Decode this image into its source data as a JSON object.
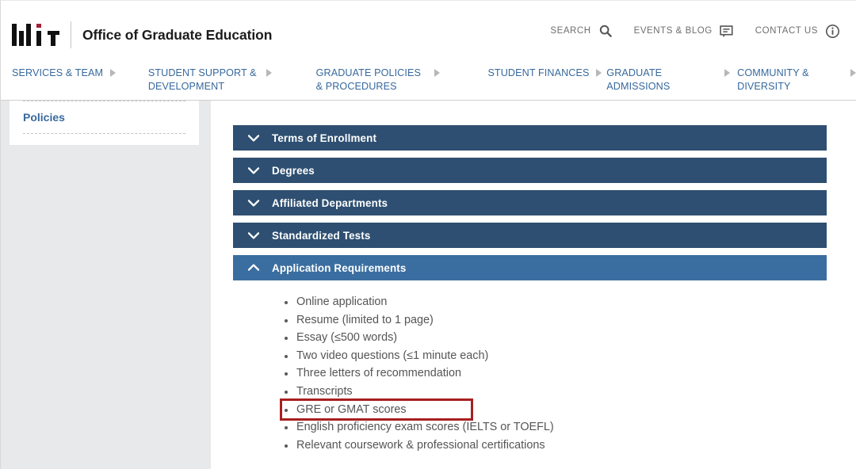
{
  "header": {
    "logo_name": "mit-logo",
    "site_title": "Office of Graduate Education",
    "utility_nav": [
      {
        "label": "SEARCH",
        "icon": "search-icon"
      },
      {
        "label": "EVENTS & BLOG",
        "icon": "speech-bubble-icon"
      },
      {
        "label": "CONTACT US",
        "icon": "info-circle-icon"
      }
    ]
  },
  "main_nav": {
    "items": [
      {
        "label": "SERVICES & TEAM",
        "arrow": "triangle-right-icon"
      },
      {
        "label": "STUDENT SUPPORT & DEVELOPMENT",
        "arrow": "triangle-right-icon"
      },
      {
        "label": "GRADUATE POLICIES & PROCEDURES",
        "arrow": "triangle-right-icon"
      },
      {
        "label": "STUDENT FINANCES",
        "arrow": "triangle-right-icon"
      },
      {
        "label": "GRADUATE ADMISSIONS",
        "arrow": "triangle-right-icon"
      },
      {
        "label": "COMMUNITY & DIVERSITY",
        "arrow": "triangle-right-icon"
      }
    ]
  },
  "sidebar": {
    "link_label": "Policies"
  },
  "accordion": {
    "sections": [
      {
        "label": "Terms of Enrollment",
        "expanded": false,
        "icon": "chevron-down-icon"
      },
      {
        "label": "Degrees",
        "expanded": false,
        "icon": "chevron-down-icon"
      },
      {
        "label": "Affiliated Departments",
        "expanded": false,
        "icon": "chevron-down-icon"
      },
      {
        "label": "Standardized Tests",
        "expanded": false,
        "icon": "chevron-down-icon"
      },
      {
        "label": "Application Requirements",
        "expanded": true,
        "icon": "chevron-up-icon"
      }
    ],
    "expanded_items": [
      {
        "text": "Online application",
        "highlighted": false
      },
      {
        "text": "Resume (limited to 1 page)",
        "highlighted": false
      },
      {
        "text": "Essay (≤500 words)",
        "highlighted": false
      },
      {
        "text": "Two video questions (≤1 minute each)",
        "highlighted": false
      },
      {
        "text": "Three letters of recommendation",
        "highlighted": false
      },
      {
        "text": "Transcripts",
        "highlighted": false
      },
      {
        "text": "GRE or GMAT scores",
        "highlighted": true
      },
      {
        "text": "English proficiency exam scores (IELTS or TOEFL)",
        "highlighted": false
      },
      {
        "text": "Relevant coursework & professional certifications",
        "highlighted": false
      }
    ]
  },
  "colors": {
    "accent_blue": "#37699e",
    "accordion_navy": "#2e4f71",
    "accordion_open_blue": "#3b6ea0",
    "mit_red": "#a31f34",
    "highlight_red": "#a81f20",
    "sidebar_gray": "#e7e9eb",
    "body_text": "#555555"
  }
}
